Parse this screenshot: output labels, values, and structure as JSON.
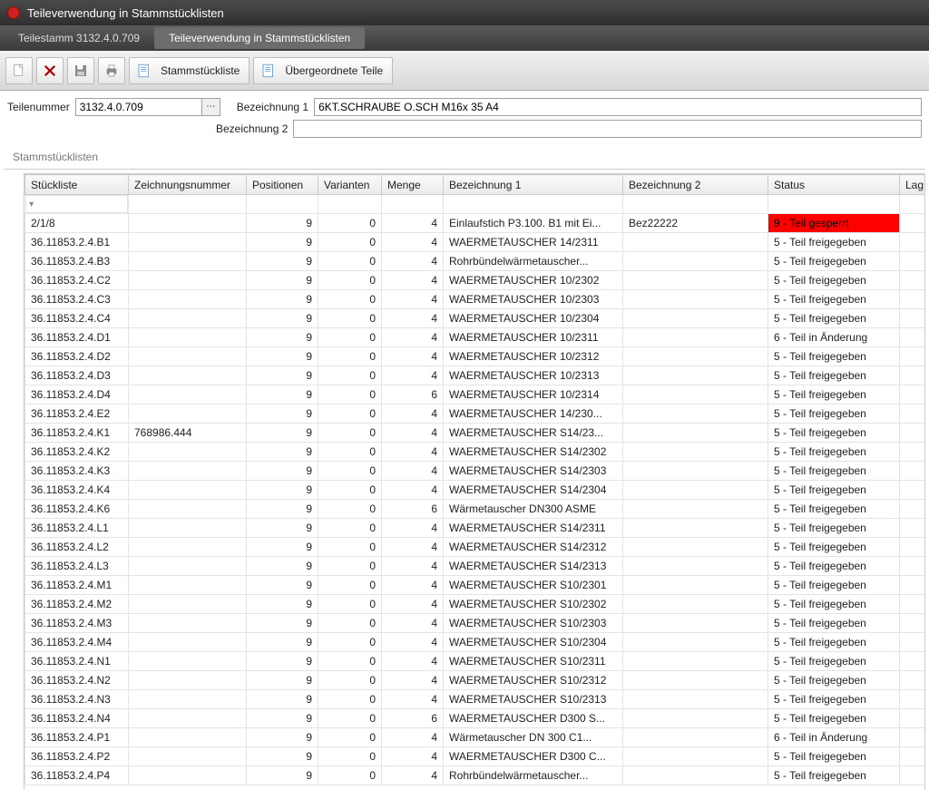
{
  "window_title": "Teileverwendung in Stammstücklisten",
  "breadcrumbs": [
    {
      "label": "Teilestamm 3132.4.0.709",
      "active": false
    },
    {
      "label": "Teileverwendung in Stammstücklisten",
      "active": true
    }
  ],
  "toolbar": {
    "btn_stammstueckliste": "Stammstückliste",
    "btn_uebergeordnete": "Übergeordnete Teile"
  },
  "fields": {
    "teilenummer_label": "Teilenummer",
    "teilenummer_value": "3132.4.0.709",
    "bez1_label": "Bezeichnung 1",
    "bez1_value": "6KT.SCHRAUBE O.SCH M16x 35 A4",
    "bez2_label": "Bezeichnung 2",
    "bez2_value": ""
  },
  "section_title": "Stammstücklisten",
  "columns": [
    "Stückliste",
    "Zeichnungsnummer",
    "Positionen",
    "Varianten",
    "Menge",
    "Bezeichnung 1",
    "Bezeichnung 2",
    "Status",
    "Lag"
  ],
  "rows": [
    {
      "stk": "2/1/8",
      "zn": "",
      "pos": 9,
      "var": 0,
      "menge": 4,
      "b1": "Einlaufstich P3.100. B1 mit Ei...",
      "b2": "Bez22222",
      "status": "9 - Teil gesperrt",
      "red": true
    },
    {
      "stk": "36.11853.2.4.B1",
      "zn": "",
      "pos": 9,
      "var": 0,
      "menge": 4,
      "b1": "WAERMETAUSCHER 14/2311",
      "b2": "",
      "status": "5 - Teil freigegeben"
    },
    {
      "stk": "36.11853.2.4.B3",
      "zn": "",
      "pos": 9,
      "var": 0,
      "menge": 4,
      "b1": "Rohrbündelwärmetauscher...",
      "b2": "",
      "status": "5 - Teil freigegeben"
    },
    {
      "stk": "36.11853.2.4.C2",
      "zn": "",
      "pos": 9,
      "var": 0,
      "menge": 4,
      "b1": "WAERMETAUSCHER 10/2302",
      "b2": "",
      "status": "5 - Teil freigegeben"
    },
    {
      "stk": "36.11853.2.4.C3",
      "zn": "",
      "pos": 9,
      "var": 0,
      "menge": 4,
      "b1": "WAERMETAUSCHER 10/2303",
      "b2": "",
      "status": "5 - Teil freigegeben"
    },
    {
      "stk": "36.11853.2.4.C4",
      "zn": "",
      "pos": 9,
      "var": 0,
      "menge": 4,
      "b1": "WAERMETAUSCHER 10/2304",
      "b2": "",
      "status": "5 - Teil freigegeben"
    },
    {
      "stk": "36.11853.2.4.D1",
      "zn": "",
      "pos": 9,
      "var": 0,
      "menge": 4,
      "b1": "WAERMETAUSCHER 10/2311",
      "b2": "",
      "status": "6 - Teil in Änderung"
    },
    {
      "stk": "36.11853.2.4.D2",
      "zn": "",
      "pos": 9,
      "var": 0,
      "menge": 4,
      "b1": "WAERMETAUSCHER 10/2312",
      "b2": "",
      "status": "5 - Teil freigegeben"
    },
    {
      "stk": "36.11853.2.4.D3",
      "zn": "",
      "pos": 9,
      "var": 0,
      "menge": 4,
      "b1": "WAERMETAUSCHER 10/2313",
      "b2": "",
      "status": "5 - Teil freigegeben"
    },
    {
      "stk": "36.11853.2.4.D4",
      "zn": "",
      "pos": 9,
      "var": 0,
      "menge": 6,
      "b1": "WAERMETAUSCHER 10/2314",
      "b2": "",
      "status": "5 - Teil freigegeben"
    },
    {
      "stk": "36.11853.2.4.E2",
      "zn": "",
      "pos": 9,
      "var": 0,
      "menge": 4,
      "b1": "WAERMETAUSCHER 14/230...",
      "b2": "",
      "status": "5 - Teil freigegeben"
    },
    {
      "stk": "36.11853.2.4.K1",
      "zn": "768986.444",
      "pos": 9,
      "var": 0,
      "menge": 4,
      "b1": "WAERMETAUSCHER S14/23...",
      "b2": "",
      "status": "5 - Teil freigegeben"
    },
    {
      "stk": "36.11853.2.4.K2",
      "zn": "",
      "pos": 9,
      "var": 0,
      "menge": 4,
      "b1": "WAERMETAUSCHER S14/2302",
      "b2": "",
      "status": "5 - Teil freigegeben"
    },
    {
      "stk": "36.11853.2.4.K3",
      "zn": "",
      "pos": 9,
      "var": 0,
      "menge": 4,
      "b1": "WAERMETAUSCHER S14/2303",
      "b2": "",
      "status": "5 - Teil freigegeben"
    },
    {
      "stk": "36.11853.2.4.K4",
      "zn": "",
      "pos": 9,
      "var": 0,
      "menge": 4,
      "b1": "WAERMETAUSCHER S14/2304",
      "b2": "",
      "status": "5 - Teil freigegeben"
    },
    {
      "stk": "36.11853.2.4.K6",
      "zn": "",
      "pos": 9,
      "var": 0,
      "menge": 6,
      "b1": "Wärmetauscher DN300 ASME",
      "b2": "",
      "status": "5 - Teil freigegeben"
    },
    {
      "stk": "36.11853.2.4.L1",
      "zn": "",
      "pos": 9,
      "var": 0,
      "menge": 4,
      "b1": "WAERMETAUSCHER S14/2311",
      "b2": "",
      "status": "5 - Teil freigegeben"
    },
    {
      "stk": "36.11853.2.4.L2",
      "zn": "",
      "pos": 9,
      "var": 0,
      "menge": 4,
      "b1": "WAERMETAUSCHER S14/2312",
      "b2": "",
      "status": "5 - Teil freigegeben"
    },
    {
      "stk": "36.11853.2.4.L3",
      "zn": "",
      "pos": 9,
      "var": 0,
      "menge": 4,
      "b1": "WAERMETAUSCHER S14/2313",
      "b2": "",
      "status": "5 - Teil freigegeben"
    },
    {
      "stk": "36.11853.2.4.M1",
      "zn": "",
      "pos": 9,
      "var": 0,
      "menge": 4,
      "b1": "WAERMETAUSCHER S10/2301",
      "b2": "",
      "status": "5 - Teil freigegeben"
    },
    {
      "stk": "36.11853.2.4.M2",
      "zn": "",
      "pos": 9,
      "var": 0,
      "menge": 4,
      "b1": "WAERMETAUSCHER S10/2302",
      "b2": "",
      "status": "5 - Teil freigegeben"
    },
    {
      "stk": "36.11853.2.4.M3",
      "zn": "",
      "pos": 9,
      "var": 0,
      "menge": 4,
      "b1": "WAERMETAUSCHER S10/2303",
      "b2": "",
      "status": "5 - Teil freigegeben"
    },
    {
      "stk": "36.11853.2.4.M4",
      "zn": "",
      "pos": 9,
      "var": 0,
      "menge": 4,
      "b1": "WAERMETAUSCHER S10/2304",
      "b2": "",
      "status": "5 - Teil freigegeben"
    },
    {
      "stk": "36.11853.2.4.N1",
      "zn": "",
      "pos": 9,
      "var": 0,
      "menge": 4,
      "b1": "WAERMETAUSCHER S10/2311",
      "b2": "",
      "status": "5 - Teil freigegeben"
    },
    {
      "stk": "36.11853.2.4.N2",
      "zn": "",
      "pos": 9,
      "var": 0,
      "menge": 4,
      "b1": "WAERMETAUSCHER S10/2312",
      "b2": "",
      "status": "5 - Teil freigegeben"
    },
    {
      "stk": "36.11853.2.4.N3",
      "zn": "",
      "pos": 9,
      "var": 0,
      "menge": 4,
      "b1": "WAERMETAUSCHER S10/2313",
      "b2": "",
      "status": "5 - Teil freigegeben"
    },
    {
      "stk": "36.11853.2.4.N4",
      "zn": "",
      "pos": 9,
      "var": 0,
      "menge": 6,
      "b1": "WAERMETAUSCHER D300 S...",
      "b2": "",
      "status": "5 - Teil freigegeben"
    },
    {
      "stk": "36.11853.2.4.P1",
      "zn": "",
      "pos": 9,
      "var": 0,
      "menge": 4,
      "b1": "Wärmetauscher  DN 300 C1...",
      "b2": "",
      "status": "6 - Teil in Änderung"
    },
    {
      "stk": "36.11853.2.4.P2",
      "zn": "",
      "pos": 9,
      "var": 0,
      "menge": 4,
      "b1": "WAERMETAUSCHER D300 C...",
      "b2": "",
      "status": "5 - Teil freigegeben"
    },
    {
      "stk": "36.11853.2.4.P4",
      "zn": "",
      "pos": 9,
      "var": 0,
      "menge": 4,
      "b1": "Rohrbündelwärmetauscher...",
      "b2": "",
      "status": "5 - Teil freigegeben"
    }
  ]
}
